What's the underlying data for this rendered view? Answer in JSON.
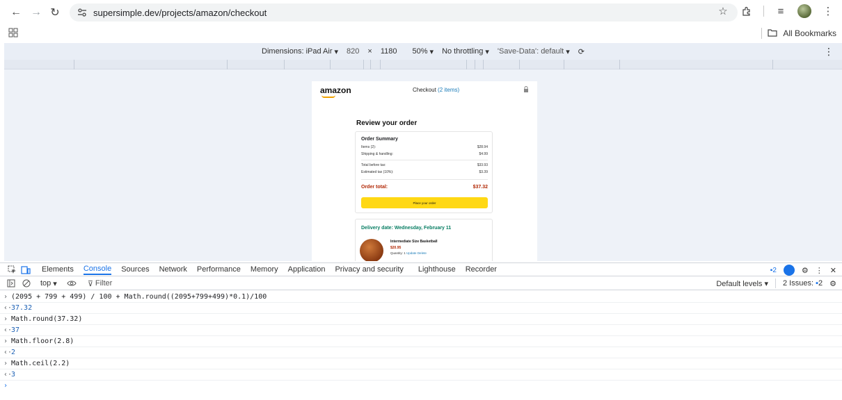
{
  "browser": {
    "url": "supersimple.dev/projects/amazon/checkout",
    "bookmarks_label": "All Bookmarks"
  },
  "device_toolbar": {
    "dimensions_label": "Dimensions: iPad Air",
    "width": "820",
    "times": "×",
    "height": "1180",
    "zoom": "50%",
    "throttling": "No throttling",
    "save_data": "'Save-Data': default"
  },
  "page": {
    "logo": "amazon",
    "checkout_title": "Checkout",
    "checkout_count": "(2 items)",
    "review_title": "Review your order",
    "summary": {
      "title": "Order Summary",
      "rows": [
        {
          "label": "Items (2):",
          "value": "$28.94"
        },
        {
          "label": "Shipping & handling:",
          "value": "$4.99"
        },
        {
          "label": "Total before tax:",
          "value": "$33.93"
        },
        {
          "label": "Estimated tax (10%):",
          "value": "$3.39"
        }
      ],
      "total_label": "Order total:",
      "total_value": "$37.32",
      "button_label": "Place your order"
    },
    "delivery_date": "Delivery date: Wednesday, February 11",
    "item": {
      "name": "Intermediate Size Basketball",
      "price": "$20.95",
      "quantity_label": "Quantity: 1",
      "update": "Update",
      "delete": "Delete"
    }
  },
  "devtools": {
    "tabs": [
      "Elements",
      "Console",
      "Sources",
      "Network",
      "Performance",
      "Memory",
      "Application",
      "Privacy and security",
      "Lighthouse",
      "Recorder"
    ],
    "active_tab": "Console",
    "message_count": "2",
    "context": "top",
    "filter_placeholder": "Filter",
    "default_levels": "Default levels",
    "issues_label": "2 Issues:",
    "issues_count": "2"
  },
  "console": {
    "entries": [
      {
        "type": "input",
        "text": "(2095 + 799  + 499) / 100 + Math.round((2095+799+499)*0.1)/100"
      },
      {
        "type": "output",
        "text": "37.32"
      },
      {
        "type": "input",
        "text": "Math.round(37.32)"
      },
      {
        "type": "output",
        "text": "37"
      },
      {
        "type": "input",
        "text": "Math.floor(2.8)"
      },
      {
        "type": "output",
        "text": "2"
      },
      {
        "type": "input",
        "text": "Math.ceil(2.2)"
      },
      {
        "type": "output",
        "text": "3"
      }
    ]
  }
}
